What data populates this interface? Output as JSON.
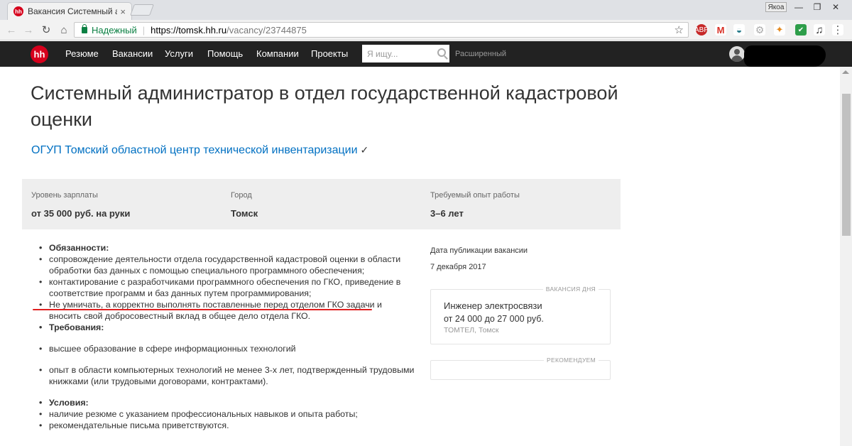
{
  "browser": {
    "tab_title": "Вакансия Системный адм",
    "tab_favicon_text": "hh",
    "profile_label": "Якоа",
    "secure_label": "Надежный",
    "url_host": "https://tomsk.hh.ru",
    "url_path": "/vacancy/23744875"
  },
  "header": {
    "logo": "hh",
    "menu": [
      "Резюме",
      "Вакансии",
      "Услуги",
      "Помощь",
      "Компании",
      "Проекты"
    ],
    "search_placeholder": "Я ищу...",
    "advanced": "Расширенный"
  },
  "vacancy": {
    "title": "Системный администратор в отдел государственной кадастровой оценки",
    "company": "ОГУП Томский областной центр технической инвентаризации",
    "verified_mark": "✓",
    "info": {
      "salary_label": "Уровень зарплаты",
      "salary_value": "от 35 000 руб. на руки",
      "city_label": "Город",
      "city_value": "Томск",
      "exp_label": "Требуемый опыт работы",
      "exp_value": "3–6 лет"
    },
    "description": {
      "duties_title": "Обязанности:",
      "duties": [
        "сопровождение деятельности отдела государственной кадастровой оценки в области обработки баз данных с помощью специального программного обеспечения;",
        "контактирование с разработчиками программного обеспечения по ГКО, приведение в соответствие программ и баз данных путем программирования;",
        "Не умничать, а корректно выполнять поставленные перед отделом ГКО задачи и вносить свой добросовестный вклад в общее дело отдела ГКО."
      ],
      "req_title": "Требования:",
      "requirements": [
        "высшее образование в сфере информационных технологий",
        "опыт в области компьютерных технологий не менее 3-х лет, подтвержденный трудовыми книжками (или трудовыми договорами, контрактами)."
      ],
      "cond_title": "Условия:",
      "conditions": [
        "наличие резюме с указанием профессиональных навыков и опыта работы;",
        "рекомендательные письма приветствуются."
      ]
    },
    "publication_label": "Дата публикации вакансии",
    "publication_date": "7 декабря 2017"
  },
  "sidebar": {
    "day_tag": "ВАКАНСИЯ ДНЯ",
    "day_job": "Инженер электросвязи",
    "day_salary": "от 24 000 до 27 000 руб.",
    "day_company": "ТОМТЕЛ, Томск",
    "recommend_tag": "РЕКОМЕНДУЕМ"
  },
  "colors": {
    "brand": "#d6001c",
    "link": "#0070c2",
    "header_bg": "#222222",
    "underline": "#e02020"
  }
}
